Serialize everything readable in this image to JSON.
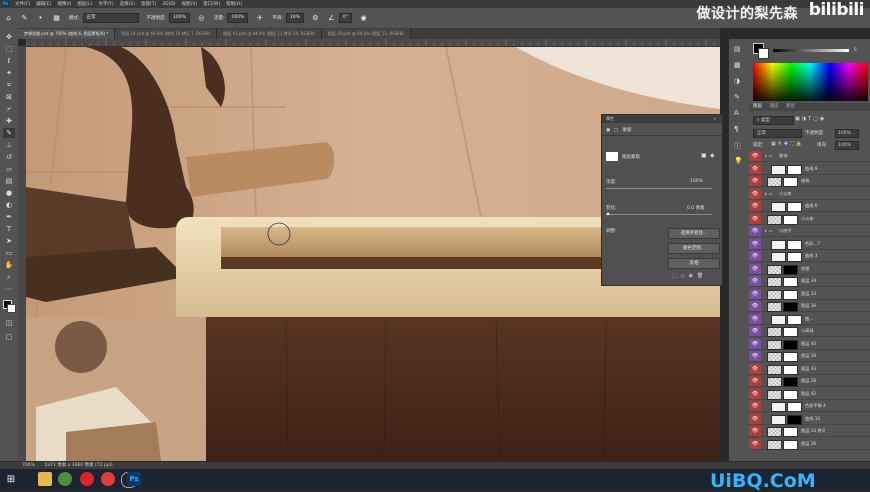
{
  "menu": [
    "文件(F)",
    "编辑(E)",
    "图像(I)",
    "图层(L)",
    "文字(Y)",
    "选择(S)",
    "滤镜(T)",
    "3D(D)",
    "视图(V)",
    "窗口(W)",
    "帮助(H)"
  ],
  "app_badge": "Ps",
  "options": {
    "mode_label": "模式:",
    "mode_value": "正常",
    "opacity_label": "不透明度:",
    "opacity_value": "100%",
    "flow_label": "流量:",
    "flow_value": "100%",
    "smooth_label": "平滑:",
    "smooth_value": "10%",
    "angle_value": "0°"
  },
  "watermark": "做设计的梨先森",
  "bilibili": "bilibili",
  "tabs": [
    {
      "label": "梦想思路.psd @ 700% (曲线 6, 图层蒙版/8) *",
      "active": true
    },
    {
      "label": "图层 14.psb @ 66.6% (曲线 19 拷贝 7, RGB/8)",
      "active": false
    },
    {
      "label": "图层 15.psb @ 64.4% (图层 11 拷贝 20, RGB/8)",
      "active": false
    },
    {
      "label": "图层 15.psb @ 64.4% (图层 11, RGB/8)",
      "active": false
    }
  ],
  "properties": {
    "title": "属性",
    "sub": "蒙版",
    "mask_label": "图层蒙版",
    "density_label": "浓度:",
    "density_value": "100%",
    "feather_label": "羽化:",
    "feather_value": "0.0 像素",
    "adjust_label": "调整:",
    "btn_select": "选择并遮住...",
    "btn_color": "颜色范围...",
    "btn_invert": "反相"
  },
  "color_panel": {
    "tab": "颜色",
    "tab2": "色板"
  },
  "layers_panel": {
    "tabs": [
      "图层",
      "通道",
      "路径"
    ],
    "filter_label": "类型",
    "blend": "正常",
    "opacity_label": "不透明度:",
    "opacity_value": "100%",
    "lock_label": "锁定:",
    "fill_label": "填充:",
    "fill_value": "100%",
    "layers": [
      {
        "name": "装饰",
        "type": "group",
        "color": "#b13d3d"
      },
      {
        "name": "曲线 9",
        "type": "adjust",
        "color": "#b13d3d"
      },
      {
        "name": "服装",
        "type": "layer",
        "color": "#b13d3d"
      },
      {
        "name": "小火车",
        "type": "group",
        "color": "#b13d3d"
      },
      {
        "name": "曲线 6",
        "type": "adjust",
        "color": "#b13d3d"
      },
      {
        "name": "小火车",
        "type": "layer",
        "color": "#b13d3d"
      },
      {
        "name": "小房子",
        "type": "group",
        "color": "#7a4ea6"
      },
      {
        "name": "色彩...7",
        "type": "adjust",
        "color": "#7a4ea6"
      },
      {
        "name": "曲线 3",
        "type": "adjust",
        "color": "#7a4ea6"
      },
      {
        "name": "房屋",
        "type": "layer",
        "color": "#7a4ea6"
      },
      {
        "name": "图层 34",
        "type": "layer",
        "color": "#7a4ea6"
      },
      {
        "name": "图层 33",
        "type": "layer",
        "color": "#7a4ea6"
      },
      {
        "name": "图层 36",
        "type": "layer",
        "color": "#7a4ea6"
      },
      {
        "name": "曲...",
        "type": "adjust",
        "color": "#7a4ea6"
      },
      {
        "name": "小高球",
        "type": "layer",
        "color": "#7a4ea6"
      },
      {
        "name": "图层 40",
        "type": "layer",
        "color": "#7a4ea6"
      },
      {
        "name": "图层 39",
        "type": "layer",
        "color": "#7a4ea6"
      },
      {
        "name": "图层 43",
        "type": "layer",
        "color": "#b13d3d"
      },
      {
        "name": "图层 28",
        "type": "layer",
        "color": "#b13d3d"
      },
      {
        "name": "图层 42",
        "type": "layer",
        "color": "#b13d3d"
      },
      {
        "name": "色彩平衡 4",
        "type": "adjust",
        "color": "#b13d3d"
      },
      {
        "name": "曲线 10",
        "type": "adjust",
        "color": "#b13d3d"
      },
      {
        "name": "图层 14 拷贝",
        "type": "layer",
        "color": "#b13d3d"
      },
      {
        "name": "图层 26",
        "type": "layer",
        "color": "#b13d3d"
      }
    ]
  },
  "status": {
    "zoom": "700%",
    "doc": "5371 像素 x 3660 像素 (72 ppi)"
  },
  "taskbar_logo": "UiBQ.CoM",
  "colors": {
    "panel": "#535353",
    "dark": "#282828",
    "layer_red": "#b13d3d",
    "layer_purple": "#7a4ea6"
  }
}
